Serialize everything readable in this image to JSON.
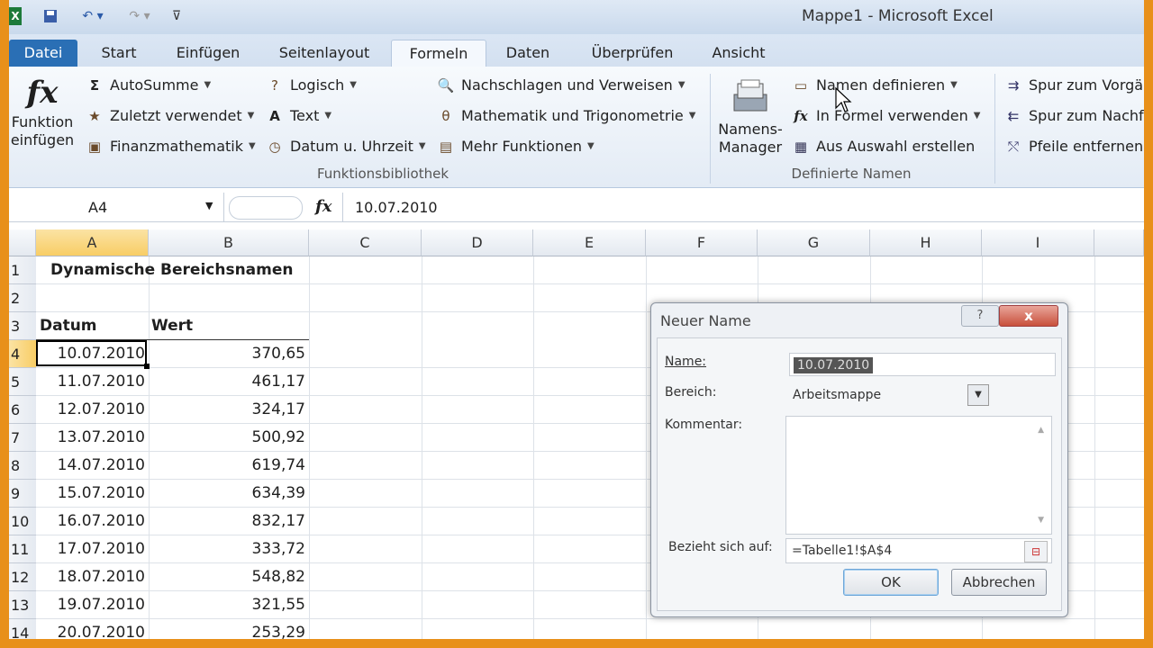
{
  "window": {
    "title": "Mappe1  -  Microsoft Excel"
  },
  "qat": {
    "icons": [
      "excel-logo-icon",
      "save-icon",
      "undo-icon",
      "redo-icon",
      "customize-qat-icon"
    ]
  },
  "tabs": [
    "Datei",
    "Start",
    "Einfügen",
    "Seitenlayout",
    "Formeln",
    "Daten",
    "Überprüfen",
    "Ansicht"
  ],
  "ribbon": {
    "insert_function": {
      "icon": "fx",
      "line1": "Funktion",
      "line2": "einfügen"
    },
    "library": {
      "autosum": "AutoSumme",
      "recent": "Zuletzt verwendet",
      "financial": "Finanzmathematik",
      "logical": "Logisch",
      "text": "Text",
      "datetime": "Datum u. Uhrzeit",
      "lookup": "Nachschlagen und Verweisen",
      "math": "Mathematik und Trigonometrie",
      "more": "Mehr Funktionen",
      "group_label": "Funktionsbibliothek"
    },
    "names": {
      "manager_line1": "Namens-",
      "manager_line2": "Manager",
      "define": "Namen definieren",
      "use_in_formula": "In Formel verwenden",
      "create_from_selection": "Aus Auswahl erstellen",
      "group_label": "Definierte Namen"
    },
    "audit": {
      "trace_precedents": "Spur zum Vorgä",
      "trace_dependents": "Spur zum Nachf",
      "remove_arrows": "Pfeile entfernen"
    }
  },
  "formula_bar": {
    "name_box": "A4",
    "fx": "fx",
    "content": "10.07.2010"
  },
  "sheet": {
    "columns": [
      "A",
      "B",
      "C",
      "D",
      "E",
      "F",
      "G",
      "H",
      "I"
    ],
    "rows": [
      "1",
      "2",
      "3",
      "4",
      "5",
      "6",
      "7",
      "8",
      "9",
      "10",
      "11",
      "12",
      "13",
      "14"
    ],
    "title": "Dynamische Bereichsnamen",
    "header_date": "Datum",
    "header_value": "Wert",
    "data": [
      {
        "date": "10.07.2010",
        "value": "370,65"
      },
      {
        "date": "11.07.2010",
        "value": "461,17"
      },
      {
        "date": "12.07.2010",
        "value": "324,17"
      },
      {
        "date": "13.07.2010",
        "value": "500,92"
      },
      {
        "date": "14.07.2010",
        "value": "619,74"
      },
      {
        "date": "15.07.2010",
        "value": "634,39"
      },
      {
        "date": "16.07.2010",
        "value": "832,17"
      },
      {
        "date": "17.07.2010",
        "value": "333,72"
      },
      {
        "date": "18.07.2010",
        "value": "548,82"
      },
      {
        "date": "19.07.2010",
        "value": "321,55"
      },
      {
        "date": "20.07.2010",
        "value": "253,29"
      }
    ]
  },
  "dialog": {
    "title": "Neuer Name",
    "help": "?",
    "close": "x",
    "name_label": "Name:",
    "name_value": "10.07.2010",
    "scope_label": "Bereich:",
    "scope_value": "Arbeitsmappe",
    "comment_label": "Kommentar:",
    "refers_label": "Bezieht sich auf:",
    "refers_value": "=Tabelle1!$A$4",
    "ok": "OK",
    "cancel": "Abbrechen"
  }
}
